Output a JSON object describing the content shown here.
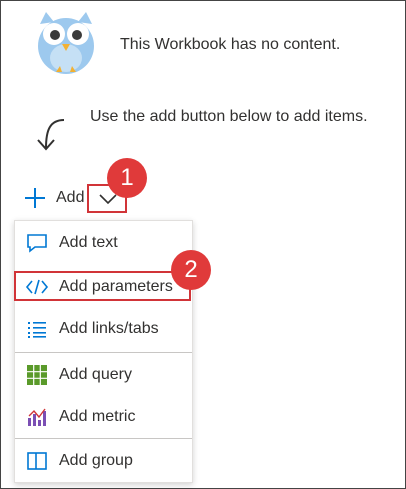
{
  "empty_state": {
    "message": "This Workbook has no content.",
    "hint": "Use the add button below to add items."
  },
  "add_button": {
    "label": "Add"
  },
  "annotations": {
    "step1": "1",
    "step2": "2"
  },
  "menu": {
    "items": [
      {
        "label": "Add text",
        "icon": "text-comment-icon"
      },
      {
        "label": "Add parameters",
        "icon": "code-icon"
      },
      {
        "label": "Add links/tabs",
        "icon": "list-links-icon"
      },
      {
        "label": "Add query",
        "icon": "grid-query-icon"
      },
      {
        "label": "Add metric",
        "icon": "bar-metric-icon"
      },
      {
        "label": "Add group",
        "icon": "group-icon"
      }
    ]
  },
  "colors": {
    "accent": "#0078d4",
    "annotation_red": "#e03a3a",
    "query_green": "#5a9a2a",
    "metric_purple": "#7b4fb4"
  }
}
